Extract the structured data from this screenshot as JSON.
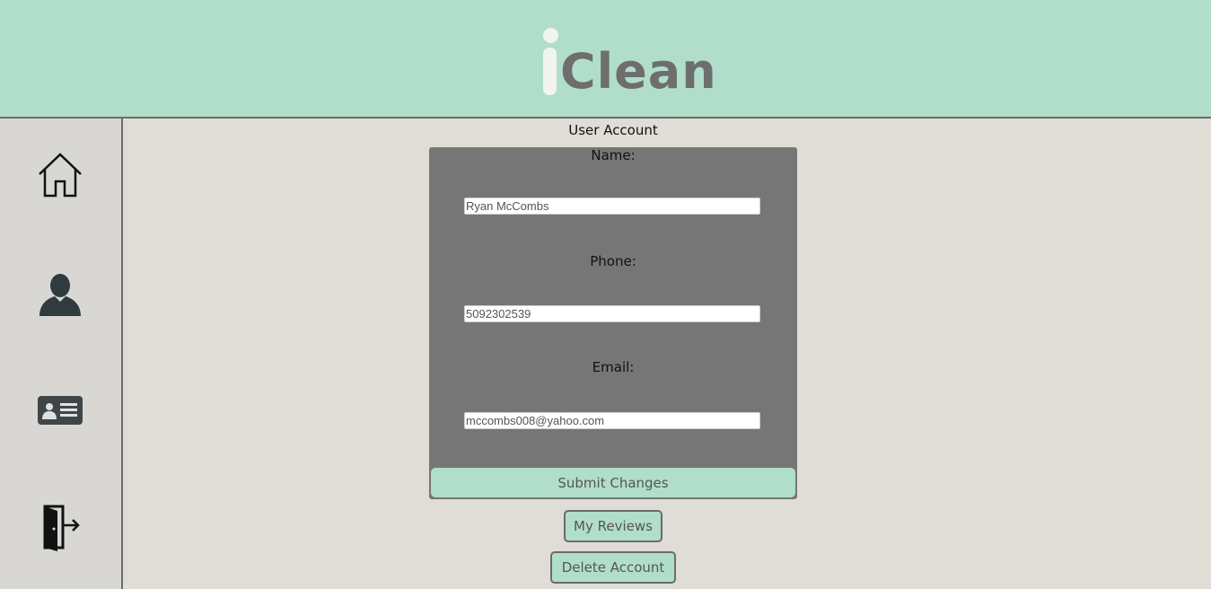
{
  "header": {
    "logo_text": "Clean"
  },
  "sidebar": {
    "items": [
      {
        "icon": "home-icon",
        "label": "Home"
      },
      {
        "icon": "user-icon",
        "label": "User Account"
      },
      {
        "icon": "id-card-icon",
        "label": "Profile Card"
      },
      {
        "icon": "logout-door-icon",
        "label": "Log Out"
      }
    ]
  },
  "main": {
    "title": "User Account",
    "form": {
      "name_label": "Name:",
      "name_value": "Ryan McCombs",
      "phone_label": "Phone:",
      "phone_value": "5092302539",
      "email_label": "Email:",
      "email_value": "mccombs008@yahoo.com",
      "submit_label": "Submit Changes"
    },
    "reviews_label": "My Reviews",
    "delete_label": "Delete Account"
  },
  "colors": {
    "accent": "#b0decb",
    "card": "#767676",
    "background": "#e0ddd7",
    "sidebar": "#d9d7d3"
  }
}
